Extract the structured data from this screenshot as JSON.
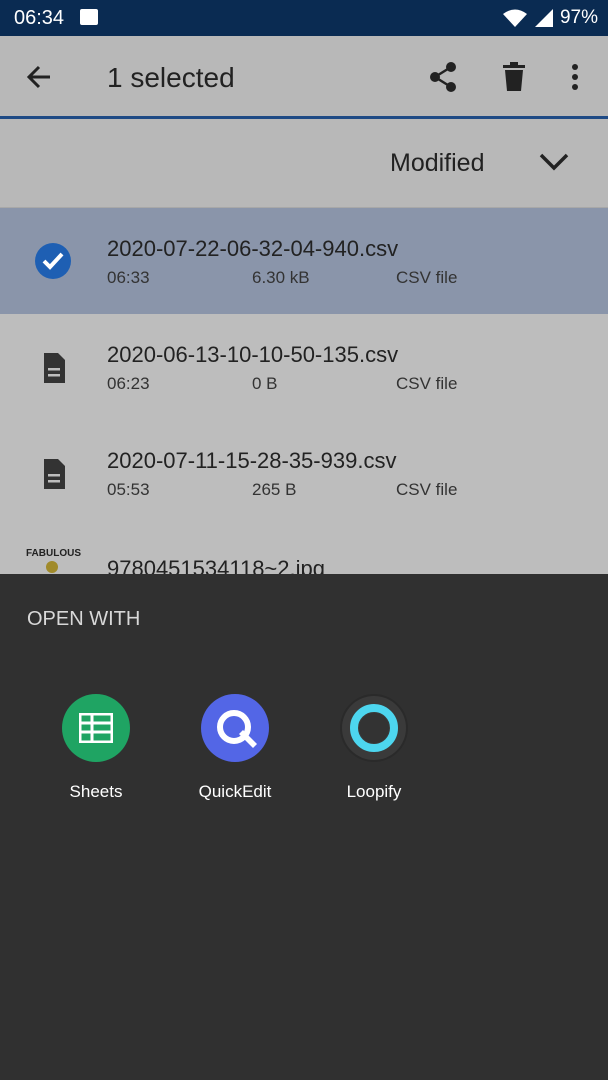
{
  "status": {
    "time": "06:34",
    "battery": "97%"
  },
  "appbar": {
    "title": "1 selected"
  },
  "sort": {
    "label": "Modified"
  },
  "files": [
    {
      "name": "2020-07-22-06-32-04-940.csv",
      "time": "06:33",
      "size": "6.30 kB",
      "kind": "CSV file",
      "selected": true
    },
    {
      "name": "2020-06-13-10-10-50-135.csv",
      "time": "06:23",
      "size": "0 B",
      "kind": "CSV file",
      "selected": false
    },
    {
      "name": "2020-07-11-15-28-35-939.csv",
      "time": "05:53",
      "size": "265 B",
      "kind": "CSV file",
      "selected": false
    },
    {
      "name": "9780451534118~2.jpg",
      "thumb_text": "FABULOUS"
    }
  ],
  "sheet": {
    "header": "OPEN WITH",
    "apps": [
      {
        "label": "Sheets",
        "icon": "sheets-icon",
        "color": "#1fa463"
      },
      {
        "label": "QuickEdit",
        "icon": "quickedit-icon",
        "color": "#5366e6"
      },
      {
        "label": "Loopify",
        "icon": "loopify-icon",
        "color": "#2a2a2a"
      }
    ]
  },
  "colors": {
    "status_bar": "#0a2b52",
    "accent": "#1e4a85",
    "selected_row": "#8a95aa",
    "sheet_bg": "#303030"
  }
}
